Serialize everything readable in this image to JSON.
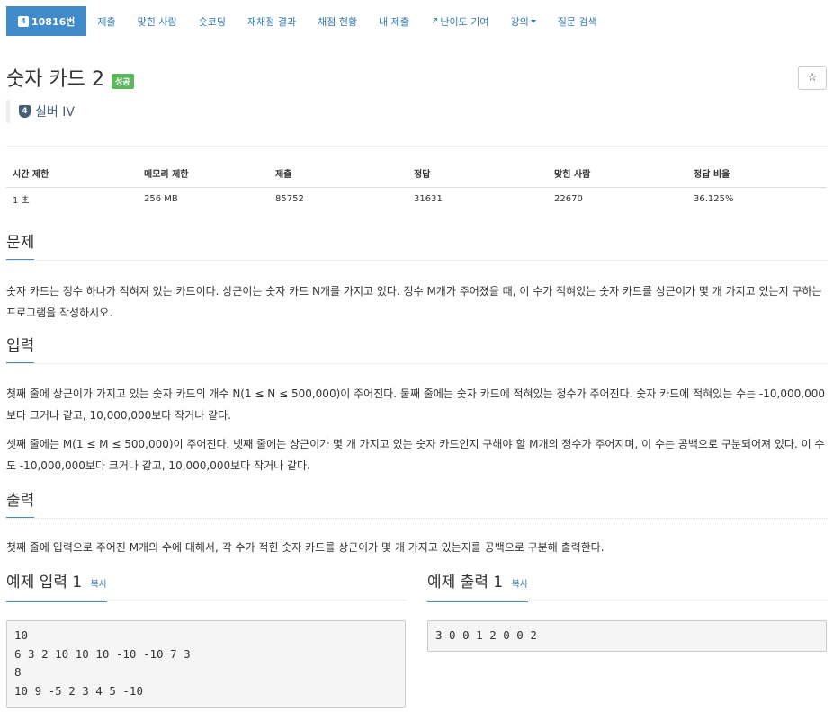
{
  "nav": {
    "problem_number": "10816번",
    "problem_icon": "4",
    "items": [
      "제출",
      "맞힌 사람",
      "숏코딩",
      "재채점 결과",
      "채점 현황",
      "내 제출",
      "난이도 기여",
      "강의",
      "질문 검색"
    ]
  },
  "problem": {
    "title": "숫자 카드 2",
    "status_label": "성공",
    "star": "☆",
    "tier_icon": "4",
    "tier": "실버 IV"
  },
  "info_table": {
    "headers": [
      "시간 제한",
      "메모리 제한",
      "제출",
      "정답",
      "맞힌 사람",
      "정답 비율"
    ],
    "values": [
      "1 초",
      "256 MB",
      "85752",
      "31631",
      "22670",
      "36.125%"
    ]
  },
  "sections": {
    "description_title": "문제",
    "description": "숫자 카드는 정수 하나가 적혀져 있는 카드이다. 상근이는 숫자 카드 N개를 가지고 있다. 정수 M개가 주어졌을 때, 이 수가 적혀있는 숫자 카드를 상근이가 몇 개 가지고 있는지 구하는 프로그램을 작성하시오.",
    "input_title": "입력",
    "input_p1": "첫째 줄에 상근이가 가지고 있는 숫자 카드의 개수 N(1 ≤ N ≤ 500,000)이 주어진다. 둘째 줄에는 숫자 카드에 적혀있는 정수가 주어진다. 숫자 카드에 적혀있는 수는 -10,000,000보다 크거나 같고, 10,000,000보다 작거나 같다.",
    "input_p2": "셋째 줄에는 M(1 ≤ M ≤ 500,000)이 주어진다. 넷째 줄에는 상근이가 몇 개 가지고 있는 숫자 카드인지 구해야 할 M개의 정수가 주어지며, 이 수는 공백으로 구분되어져 있다. 이 수도 -10,000,000보다 크거나 같고, 10,000,000보다 작거나 같다.",
    "output_title": "출력",
    "output": "첫째 줄에 입력으로 주어진 M개의 수에 대해서, 각 수가 적힌 숫자 카드를 상근이가 몇 개 가지고 있는지를 공백으로 구분해 출력한다."
  },
  "samples": {
    "input_title": "예제 입력 1",
    "output_title": "예제 출력 1",
    "copy_label": "복사",
    "input": "10\n6 3 2 10 10 10 -10 -10 7 3\n8\n10 9 -5 2 3 4 5 -10",
    "output": "3 0 0 1 2 0 0 2"
  }
}
